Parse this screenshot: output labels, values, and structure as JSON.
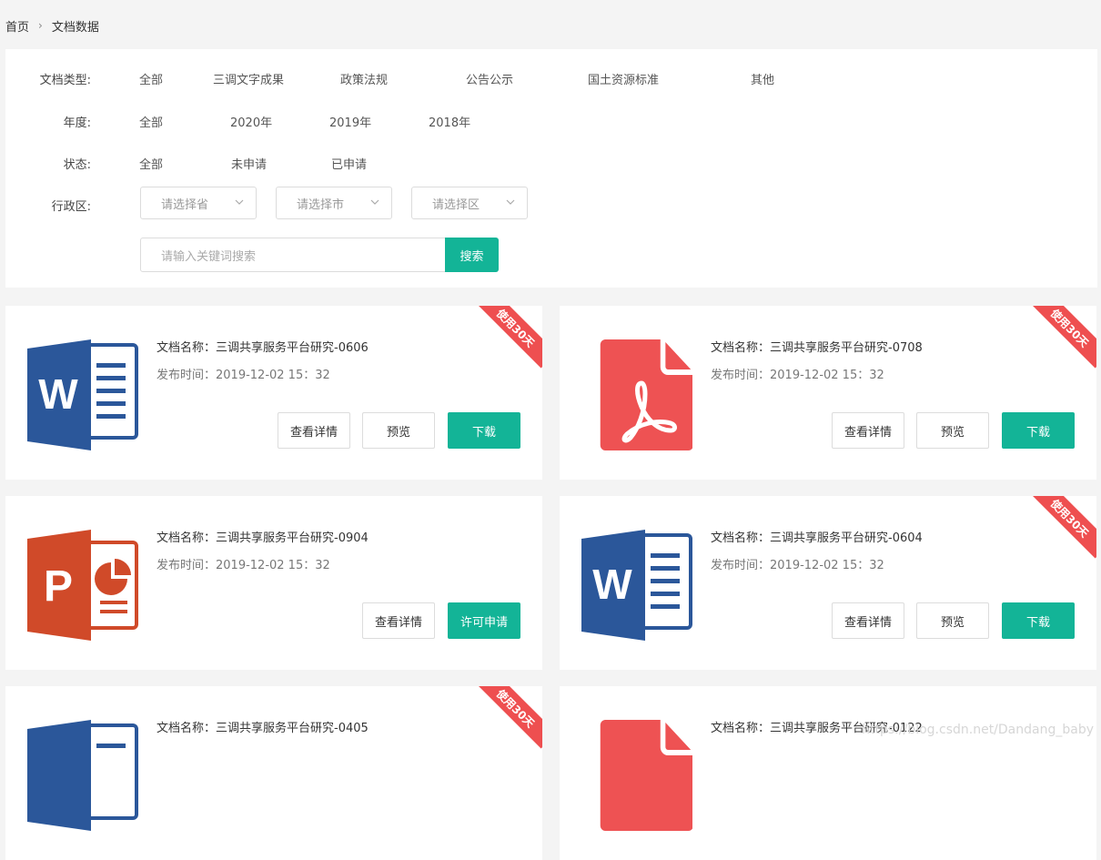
{
  "breadcrumb": {
    "home": "首页",
    "current": "文档数据"
  },
  "filters": {
    "doc_type_label": "文档类型:",
    "doc_types": [
      "全部",
      "三调文字成果",
      "政策法规",
      "公告公示",
      "国土资源标准",
      "其他"
    ],
    "year_label": "年度:",
    "years": [
      "全部",
      "2020年",
      "2019年",
      "2018年"
    ],
    "status_label": "状态:",
    "statuses": [
      "全部",
      "未申请",
      "已申请"
    ],
    "region_label": "行政区:",
    "province_placeholder": "请选择省",
    "city_placeholder": "请选择市",
    "district_placeholder": "请选择区",
    "search_placeholder": "请输入关键词搜索",
    "search_button": "搜索"
  },
  "cards": [
    {
      "type": "word",
      "name": "文档名称：三调共享服务平台研究-0606",
      "time": "发布时间：2019-12-02  15：32",
      "badge": "使用30天",
      "buttons": [
        "查看详情",
        "预览",
        "下载"
      ]
    },
    {
      "type": "pdf",
      "name": "文档名称：三调共享服务平台研究-0708",
      "time": "发布时间：2019-12-02  15：32",
      "badge": "使用30天",
      "buttons": [
        "查看详情",
        "预览",
        "下载"
      ]
    },
    {
      "type": "ppt",
      "name": "文档名称：三调共享服务平台研究-0904",
      "time": "发布时间：2019-12-02  15：32",
      "badge": "",
      "buttons": [
        "查看详情",
        "许可申请"
      ]
    },
    {
      "type": "word",
      "name": "文档名称：三调共享服务平台研究-0604",
      "time": "发布时间：2019-12-02  15：32",
      "badge": "使用30天",
      "buttons": [
        "查看详情",
        "预览",
        "下载"
      ]
    },
    {
      "type": "word",
      "name": "文档名称：三调共享服务平台研究-0405",
      "time": "",
      "badge": "使用30天",
      "buttons": []
    },
    {
      "type": "pdf",
      "name": "文档名称：三调共享服务平台研究-0122",
      "time": "",
      "badge": "",
      "buttons": []
    }
  ],
  "watermark": "https://blog.csdn.net/Dandang_baby",
  "colors": {
    "accent": "#13b497",
    "ribbon": "#ee4f50",
    "word": "#2b579a",
    "pdf": "#ee5253",
    "ppt": "#d04a29"
  }
}
